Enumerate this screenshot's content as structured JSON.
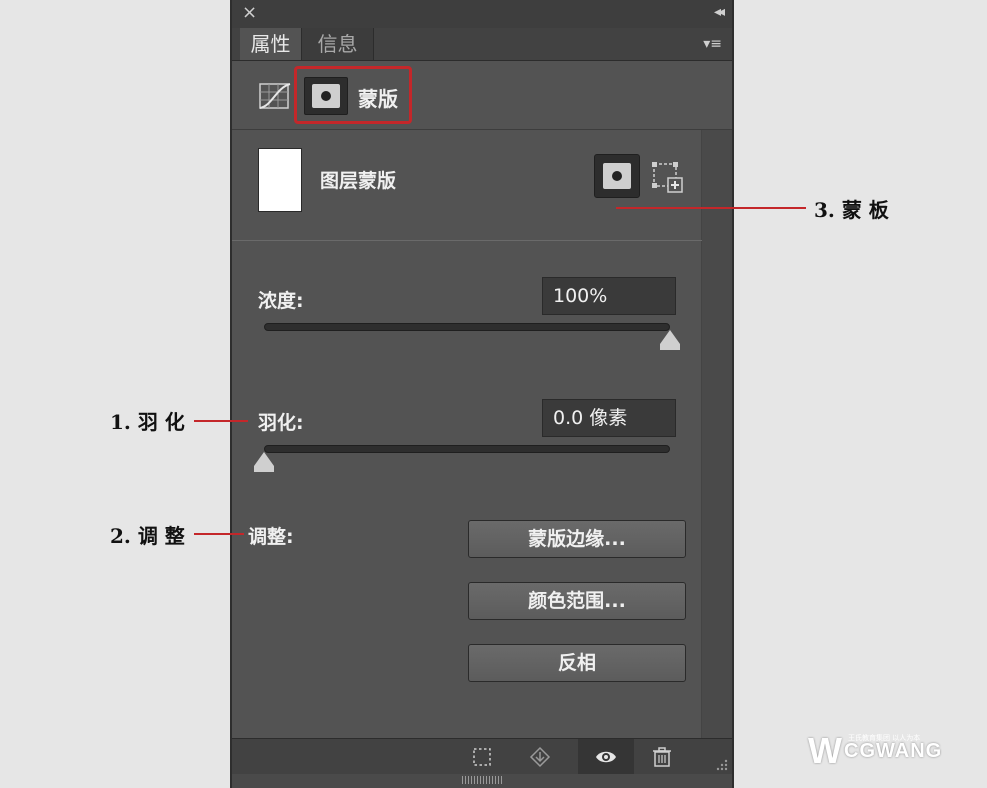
{
  "panel": {
    "close_glyph": "×",
    "collapse_glyph": "◂◂",
    "menu_glyph": "▾≡"
  },
  "tabs": [
    {
      "label": "属性",
      "active": true
    },
    {
      "label": "信息",
      "active": false
    }
  ],
  "mask_section": {
    "label": "蒙版",
    "highlight_color": "#c4272a"
  },
  "layer": {
    "label": "图层蒙版"
  },
  "density": {
    "label": "浓度:",
    "value": "100%",
    "slider_percent": 100
  },
  "feather": {
    "label": "羽化:",
    "value": "0.0 像素",
    "slider_percent": 0
  },
  "refine": {
    "label": "调整:",
    "buttons": [
      "蒙版边缘...",
      "颜色范围...",
      "反相"
    ]
  },
  "annotations": [
    {
      "text": "3. 蒙 板"
    },
    {
      "text": "1. 羽 化"
    },
    {
      "text": "2. 调 整"
    }
  ],
  "watermark": {
    "mark": "W",
    "text": "CGWANG",
    "tagline": "王氏教育集团  以人为本"
  },
  "icons": {
    "close": "close-icon",
    "collapse": "double-chevron-left-icon",
    "panel_menu": "panel-menu-icon",
    "curves": "curves-adjustment-icon",
    "pixel_mask": "pixel-mask-icon",
    "vector_mask": "vector-mask-add-icon",
    "load_selection": "selection-from-mask-icon",
    "apply_mask": "apply-mask-icon",
    "visibility": "eye-icon",
    "delete": "trash-icon"
  }
}
